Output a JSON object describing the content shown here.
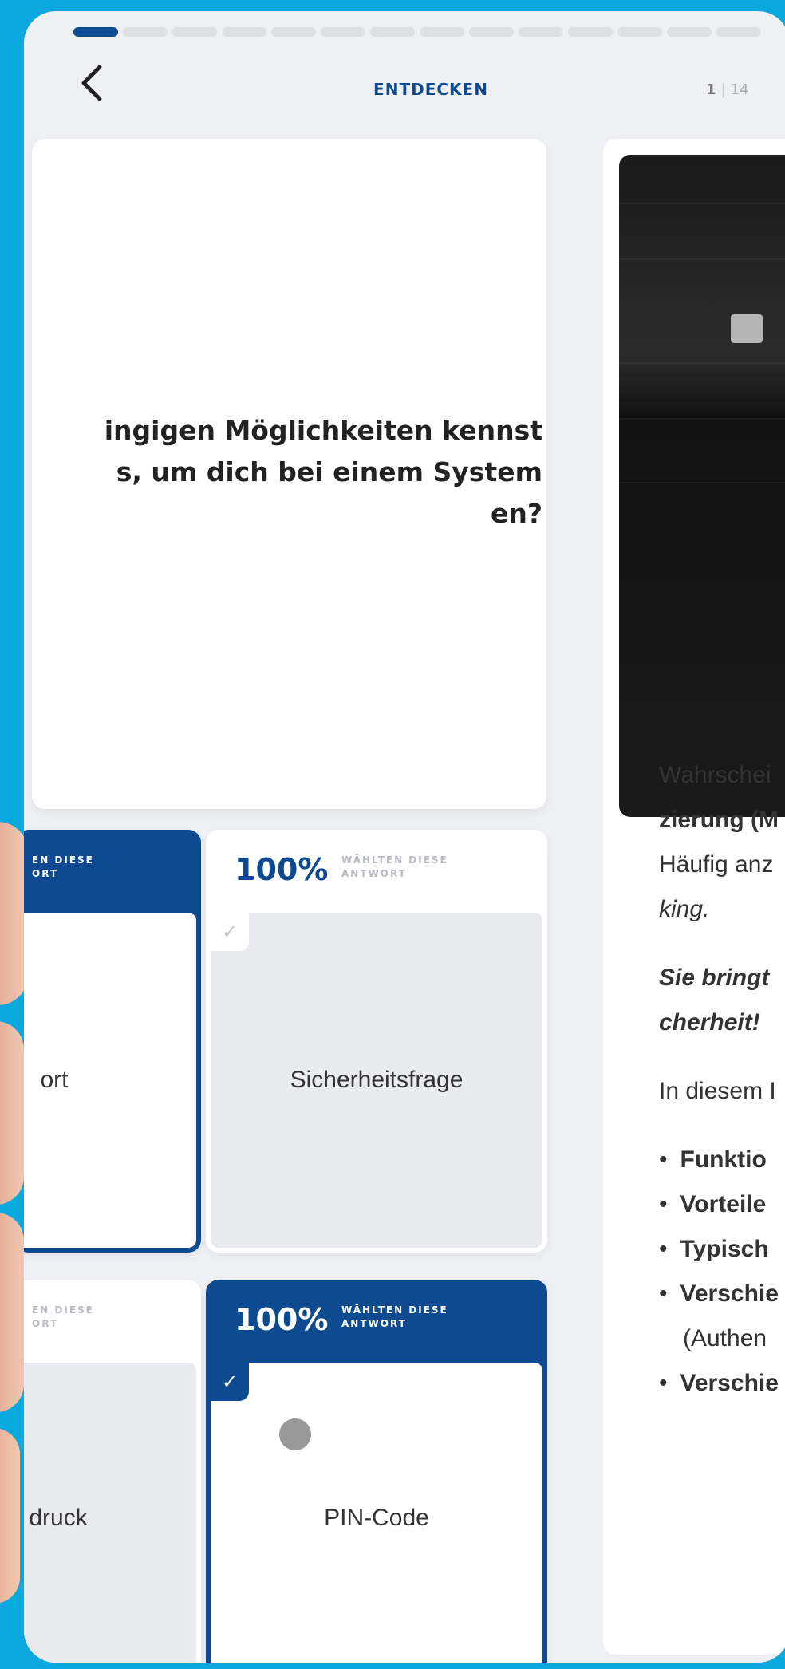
{
  "header": {
    "title": "ENTDECKEN",
    "page_current": "1",
    "page_total": "14",
    "progress_segments": 14,
    "progress_active": 1
  },
  "question": {
    "lines": [
      "ingigen Möglichkeiten kennst",
      "s, um dich bei einem System",
      "en?"
    ]
  },
  "tiles": [
    {
      "pct": "",
      "note_1": "EN DIESE",
      "note_2": "ORT",
      "label": "ort",
      "selected": true
    },
    {
      "pct": "100%",
      "note_1": "WÄHLTEN DIESE",
      "note_2": "ANTWORT",
      "label": "Sicherheitsfrage",
      "selected": false
    },
    {
      "pct": "",
      "note_1": "EN DIESE",
      "note_2": "ORT",
      "label": "druck",
      "selected": false
    },
    {
      "pct": "100%",
      "note_1": "WÄHLTEN DIESE",
      "note_2": "ANTWORT",
      "label": "PIN-Code",
      "selected": true
    }
  ],
  "panel": {
    "p1_l1": "Wahrschei",
    "p1_l2": "zierung (M",
    "p1_l3": "Häufig anz",
    "p1_l4": "king.",
    "p2_l1": "Sie bringt",
    "p2_l2": "cherheit!",
    "p3": "In diesem I",
    "bullets": [
      "Funktio",
      "Vorteile",
      "Typisch",
      "Verschie",
      "Verschie"
    ],
    "bullet_sub": "(Authen"
  },
  "colors": {
    "background": "#0ba8df",
    "accent": "#0d4a90"
  }
}
